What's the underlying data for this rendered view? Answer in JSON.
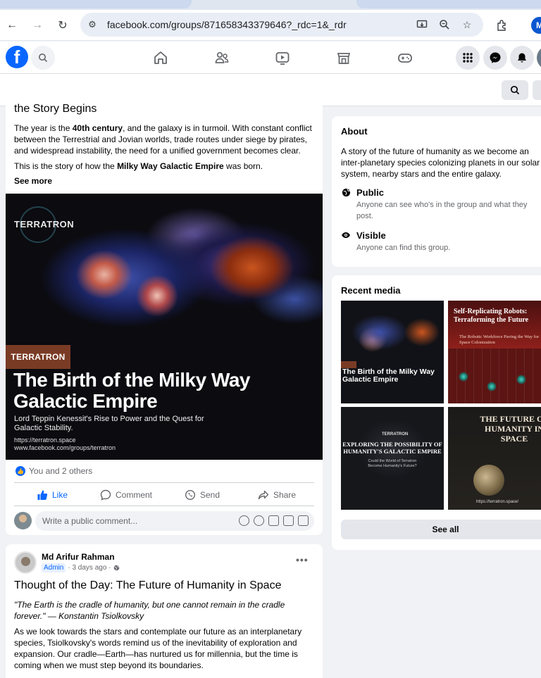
{
  "browser": {
    "url": "facebook.com/groups/871658343379646?_rdc=1&_rdr",
    "profile_initial": "M"
  },
  "post1": {
    "title_partial": "the Story Begins",
    "para1_pre": "The year is the ",
    "para1_bold": "40th century",
    "para1_post": ", and the galaxy is in turmoil. With constant conflict between the Terrestrial and Jovian worlds, trade routes under siege by pirates, and widespread instability, the need for a unified government becomes clear.",
    "para2_pre": "This is the story of how the ",
    "para2_bold": "Milky Way Galactic Empire",
    "para2_post": " was born.",
    "see_more": "See more",
    "image": {
      "logo_text": "TERRATRON",
      "tag": "TERRATRON",
      "headline": "The Birth of the Milky Way Galactic Empire",
      "subtitle": "Lord Teppin Kenessit's Rise to Power and the Quest for Galactic Stability.",
      "url1": "https://terratron.space",
      "url2": "www.facebook.com/groups/terratron"
    },
    "reactions_text": "You and 2 others",
    "actions": {
      "like": "Like",
      "comment": "Comment",
      "send": "Send",
      "share": "Share"
    },
    "comment_placeholder": "Write a public comment..."
  },
  "post2": {
    "author": "Md Arifur Rahman",
    "badge": "Admin",
    "time": "· 3 days ago ·",
    "title": "Thought of the Day: The Future of Humanity in Space",
    "quote": "\"The Earth is the cradle of humanity, but one cannot remain in the cradle forever.\" — Konstantin Tsiolkovsky",
    "body": "As we look towards the stars and contemplate our future as an interplanetary species, Tsiolkovsky's words remind us of the inevitability of exploration and expansion. Our cradle—Earth—has nurtured us for millennia, but the time is coming when we must step beyond its boundaries."
  },
  "about": {
    "heading": "About",
    "description": "A story of the future of humanity as we become an inter-planetary species colonizing planets in our solar system, nearby stars and the entire galaxy.",
    "public_title": "Public",
    "public_text": "Anyone can see who's in the group and what they post.",
    "visible_title": "Visible",
    "visible_text": "Anyone can find this group."
  },
  "media": {
    "heading": "Recent media",
    "see_all": "See all",
    "thumb1": {
      "headline": "The Birth of the Milky Way Galactic Empire"
    },
    "thumb2": {
      "headline": "Self-Replicating Robots: Terraforming the Future",
      "sub": "The Robotic Workforce Paving the Way for Space Colonization"
    },
    "thumb3": {
      "logo": "TERRATRON",
      "headline": "EXPLORING THE POSSIBILITY OF HUMANITY'S GALACTIC EMPIRE",
      "sub": "Could the World of Terratron Become Humanity's Future?"
    },
    "thumb4": {
      "headline": "THE FUTURE OF HUMANITY IN SPACE",
      "url": "https://terratron.space/"
    }
  },
  "colors": {
    "facebook_blue": "#0866ff",
    "page_bg": "#f0f2f5",
    "terratron_tag": "#7a3b25"
  }
}
